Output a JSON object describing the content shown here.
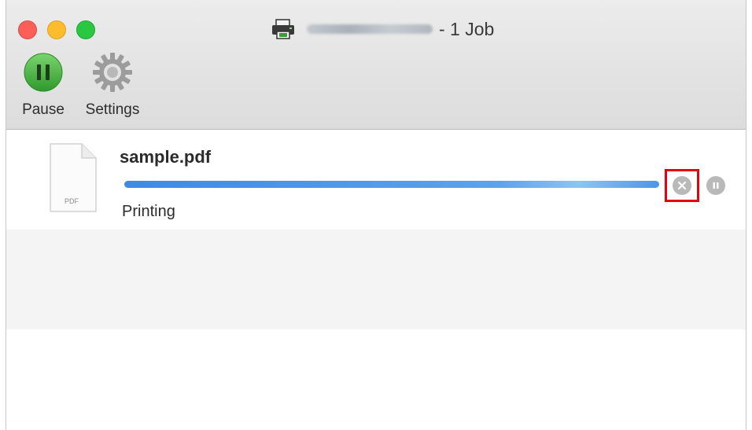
{
  "window": {
    "title_suffix": "- 1 Job"
  },
  "toolbar": {
    "pause_label": "Pause",
    "settings_label": "Settings"
  },
  "job": {
    "file_name": "sample.pdf",
    "status": "Printing",
    "progress": 1.0,
    "doc_badge": "PDF"
  },
  "icons": {
    "close_window": "close-icon",
    "minimize_window": "minimize-icon",
    "zoom_window": "zoom-icon",
    "printer": "printer-icon",
    "pause": "pause-icon",
    "settings": "gear-icon",
    "document": "pdf-document-icon",
    "cancel_job": "cancel-icon",
    "hold_job": "hold-icon"
  },
  "colors": {
    "progress": "#3b8be6",
    "close_button": "#fc5f57",
    "minimize_button": "#fdbc2e",
    "zoom_button": "#29c840",
    "pause_button": "#3fa83b",
    "highlight_box": "#e60012"
  }
}
